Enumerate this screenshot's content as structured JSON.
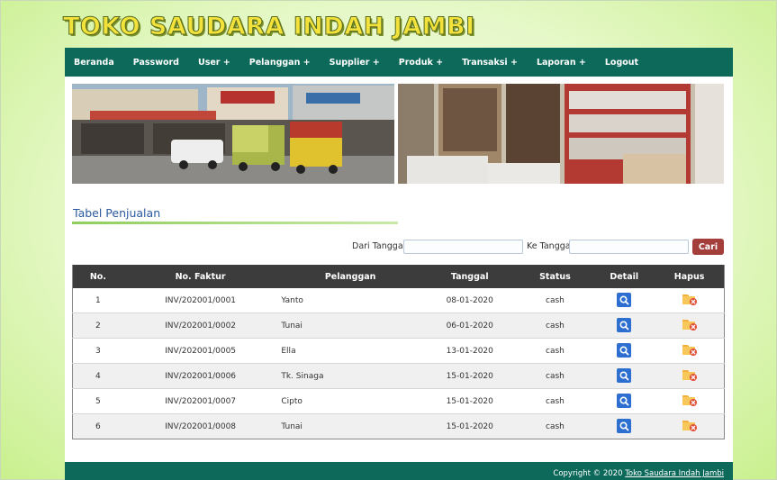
{
  "site": {
    "title": "TOKO SAUDARA INDAH JAMBI"
  },
  "nav": {
    "items": [
      {
        "label": "Beranda"
      },
      {
        "label": "Password"
      },
      {
        "label": "User +"
      },
      {
        "label": "Pelanggan +"
      },
      {
        "label": "Supplier +"
      },
      {
        "label": "Produk +"
      },
      {
        "label": "Transaksi +"
      },
      {
        "label": "Laporan +"
      },
      {
        "label": "Logout"
      }
    ]
  },
  "section": {
    "title": "Tabel Penjualan"
  },
  "filter": {
    "from_label": "Dari Tanggal:",
    "from_value": "",
    "to_label": "Ke Tanggal",
    "to_value": "",
    "search_label": "Cari"
  },
  "table": {
    "headers": [
      "No.",
      "No. Faktur",
      "Pelanggan",
      "Tanggal",
      "Status",
      "Detail",
      "Hapus"
    ],
    "rows": [
      {
        "no": "1",
        "faktur": "INV/202001/0001",
        "pelanggan": "Yanto",
        "tanggal": "08-01-2020",
        "status": "cash"
      },
      {
        "no": "2",
        "faktur": "INV/202001/0002",
        "pelanggan": "Tunai",
        "tanggal": "06-01-2020",
        "status": "cash"
      },
      {
        "no": "3",
        "faktur": "INV/202001/0005",
        "pelanggan": "Ella",
        "tanggal": "13-01-2020",
        "status": "cash"
      },
      {
        "no": "4",
        "faktur": "INV/202001/0006",
        "pelanggan": "Tk. Sinaga",
        "tanggal": "15-01-2020",
        "status": "cash"
      },
      {
        "no": "5",
        "faktur": "INV/202001/0007",
        "pelanggan": "Cipto",
        "tanggal": "15-01-2020",
        "status": "cash"
      },
      {
        "no": "6",
        "faktur": "INV/202001/0008",
        "pelanggan": "Tunai",
        "tanggal": "15-01-2020",
        "status": "cash"
      }
    ]
  },
  "footer": {
    "copyright": "Copyright © 2020",
    "link": "Toko Saudara Indah Jambi"
  },
  "icons": {
    "detail": "search-icon",
    "delete": "folder-delete-icon"
  },
  "colors": {
    "nav": "#0d6a5b",
    "title": "#f4e23c",
    "search_button": "#a33e3a",
    "detail_button": "#2d6fd1",
    "table_header": "#3c3c3c"
  }
}
